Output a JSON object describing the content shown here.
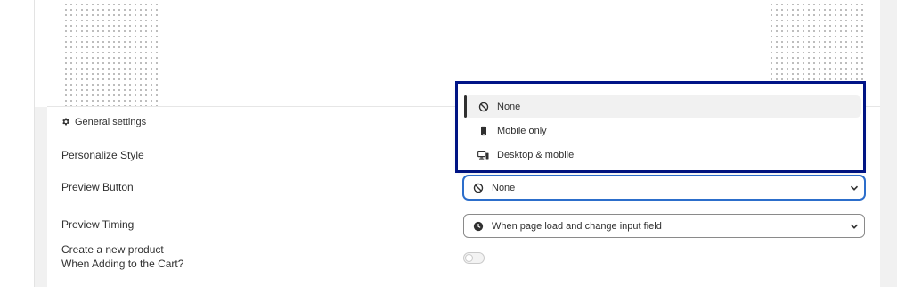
{
  "section": {
    "title": "General settings",
    "icon": "gear-icon"
  },
  "rows": {
    "personalize_style": {
      "label": "Personalize Style"
    },
    "preview_button": {
      "label": "Preview Button",
      "selected_value": "None",
      "selected_icon": "block-icon"
    },
    "preview_timing": {
      "label": "Preview Timing",
      "selected_value": "When page load and change input field",
      "selected_icon": "clock-icon"
    },
    "create_product": {
      "label_line1": "Create a new product",
      "label_line2": "When Adding to the Cart?",
      "enabled": false
    }
  },
  "dropdown": {
    "options": [
      {
        "label": "None",
        "icon": "block-icon",
        "selected": true
      },
      {
        "label": "Mobile only",
        "icon": "mobile-icon",
        "selected": false
      },
      {
        "label": "Desktop & mobile",
        "icon": "desktop-mobile-icon",
        "selected": false
      }
    ]
  },
  "colors": {
    "focus": "#2c6ecb",
    "highlight_box": "#00158a",
    "text": "#303030"
  }
}
